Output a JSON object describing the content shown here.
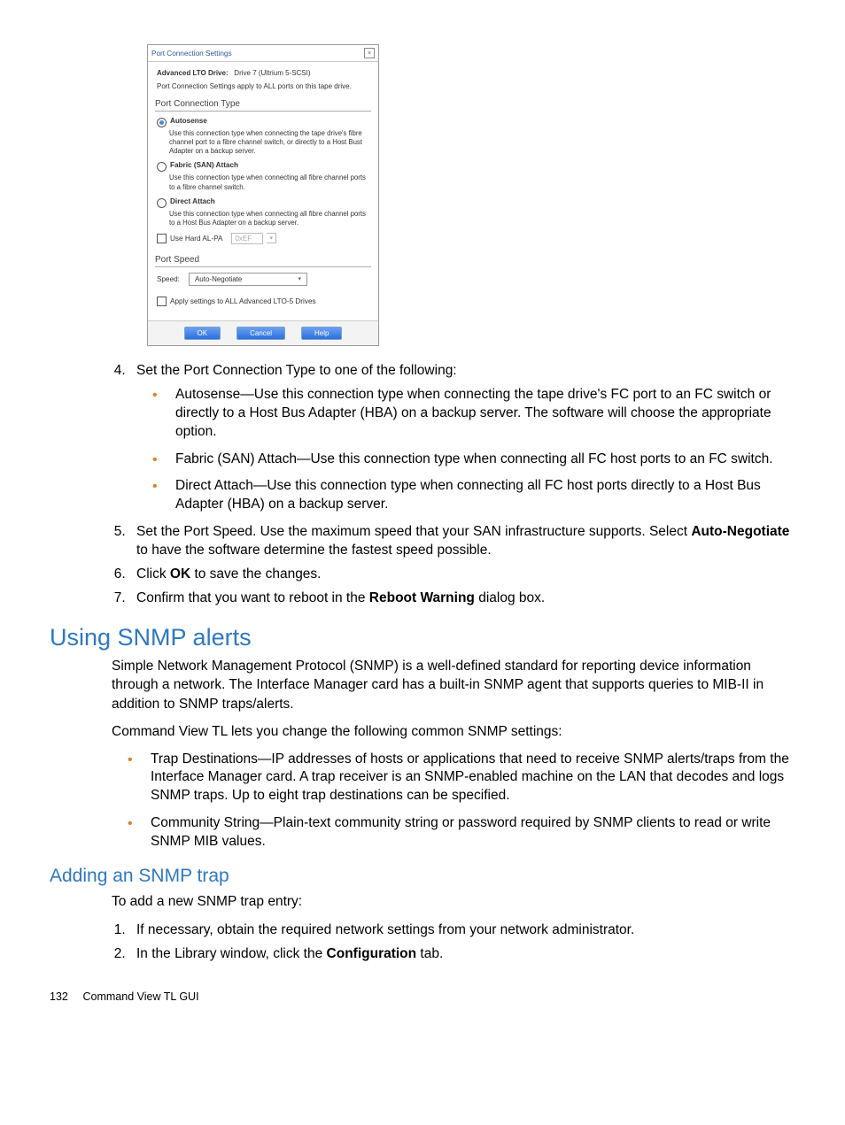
{
  "dialog": {
    "title": "Port Connection Settings",
    "drive_label": "Advanced LTO Drive:",
    "drive_value": "Drive 7 (Ultrium 5-SCSI)",
    "apply_note": "Port Connection Settings apply to ALL ports on this tape drive.",
    "section_conn_type": "Port Connection Type",
    "opt_autosense": "Autosense",
    "opt_autosense_desc": "Use this connection type when connecting the tape drive's fibre channel port to a fibre channel switch, or directly to a Host Bust Adapter on a backup server.",
    "opt_fabric": "Fabric (SAN) Attach",
    "opt_fabric_desc": "Use this connection type when connecting all fibre channel ports to a fibre channel switch.",
    "opt_direct": "Direct Attach",
    "opt_direct_desc": "Use this connection type when connecting all fibre channel ports to a Host Bus Adapter on a backup server.",
    "alpa_label": "Use Hard AL-PA",
    "alpa_value": "0xEF",
    "section_speed": "Port Speed",
    "speed_label": "Speed:",
    "speed_value": "Auto-Negotiate",
    "apply_all_label": "Apply settings to ALL Advanced LTO-5 Drives",
    "btn_ok": "OK",
    "btn_cancel": "Cancel",
    "btn_help": "Help"
  },
  "steps_a": {
    "s4": "Set the Port Connection Type to one of the following:",
    "b1": "Autosense—Use this connection type when connecting the tape drive's FC port to an FC switch or directly to a Host Bus Adapter (HBA) on a backup server. The software will choose the appropriate option.",
    "b2": "Fabric (SAN) Attach—Use this connection type when connecting all FC host ports to an FC switch.",
    "b3": "Direct Attach—Use this connection type when connecting all FC host ports directly to a Host Bus Adapter (HBA) on a backup server.",
    "s5_a": "Set the Port Speed. Use the maximum speed that your SAN infrastructure supports. Select ",
    "s5_b": "Auto-Negotiate",
    "s5_c": " to have the software determine the fastest speed possible.",
    "s6_a": "Click ",
    "s6_b": "OK",
    "s6_c": " to save the changes.",
    "s7_a": "Confirm that you want to reboot in the ",
    "s7_b": "Reboot Warning",
    "s7_c": " dialog box."
  },
  "snmp": {
    "heading": "Using SNMP alerts",
    "p1": "Simple Network Management Protocol (SNMP) is a well-defined standard for reporting device information through a network. The Interface Manager card has a built-in SNMP agent that supports queries to MIB-II in addition to SNMP traps/alerts.",
    "p2": "Command View TL lets you change the following common SNMP settings:",
    "b1": "Trap Destinations—IP addresses of hosts or applications that need to receive SNMP alerts/traps from the Interface Manager card. A trap receiver is an SNMP-enabled machine on the LAN that decodes and logs SNMP traps. Up to eight trap destinations can be specified.",
    "b2": "Community String—Plain-text community string or password required by SNMP clients to read or write SNMP MIB values."
  },
  "addtrap": {
    "heading": "Adding an SNMP trap",
    "p1": "To add a new SNMP trap entry:",
    "s1": "If necessary, obtain the required network settings from your network administrator.",
    "s2_a": "In the Library window, click the ",
    "s2_b": "Configuration",
    "s2_c": " tab."
  },
  "footer": {
    "page": "132",
    "label": "Command View TL GUI"
  }
}
